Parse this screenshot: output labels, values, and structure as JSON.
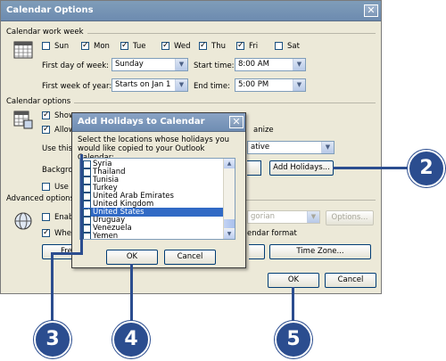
{
  "dialog": {
    "title": "Calendar Options",
    "close_symbol": "✕",
    "work_week_group": "Calendar work week",
    "days": [
      {
        "label": "Sun",
        "checked": false
      },
      {
        "label": "Mon",
        "checked": true
      },
      {
        "label": "Tue",
        "checked": true
      },
      {
        "label": "Wed",
        "checked": true
      },
      {
        "label": "Thu",
        "checked": true
      },
      {
        "label": "Fri",
        "checked": true
      },
      {
        "label": "Sat",
        "checked": false
      }
    ],
    "first_day_label": "First day of week:",
    "first_day_value": "Sunday",
    "start_time_label": "Start time:",
    "start_time_value": "8:00 AM",
    "first_week_label": "First week of year:",
    "first_week_value": "Starts on Jan 1",
    "end_time_label": "End time:",
    "end_time_value": "5:00 PM",
    "options_group": "Calendar options",
    "show_frag": "Show",
    "allow_frag": "Allow",
    "organize_frag": "anize",
    "use_this_frag": "Use this r",
    "ative_frag": "ative",
    "background_frag": "Backgrou",
    "use_se_frag": "Use se",
    "add_holidays_button": "Add Holidays...",
    "advanced_group": "Advanced options",
    "enable_frag": "Enable",
    "gorian_frag": "gorian",
    "options_button": "Options...",
    "when_frag": "When",
    "endar_format_frag": "endar format",
    "fre_frag": "Fre",
    "time_zone_button": "Time Zone...",
    "ok_button": "OK",
    "cancel_button": "Cancel"
  },
  "holidays_dialog": {
    "title": "Add Holidays to Calendar",
    "close_symbol": "✕",
    "instructions": "Select the locations whose holidays you would like copied to your Outlook Calendar:",
    "locations": [
      {
        "name": "Syria",
        "checked": false
      },
      {
        "name": "Thailand",
        "checked": false
      },
      {
        "name": "Tunisia",
        "checked": false
      },
      {
        "name": "Turkey",
        "checked": false
      },
      {
        "name": "United Arab Emirates",
        "checked": false
      },
      {
        "name": "United Kingdom",
        "checked": false
      },
      {
        "name": "United States",
        "checked": true,
        "selected": true
      },
      {
        "name": "Uruguay",
        "checked": false
      },
      {
        "name": "Venezuela",
        "checked": false
      },
      {
        "name": "Yemen",
        "checked": false
      }
    ],
    "ok_button": "OK",
    "cancel_button": "Cancel"
  },
  "callouts": [
    "2",
    "3",
    "4",
    "5"
  ],
  "colors": {
    "callout": "#2b4d8f",
    "selection": "#316ac5"
  }
}
